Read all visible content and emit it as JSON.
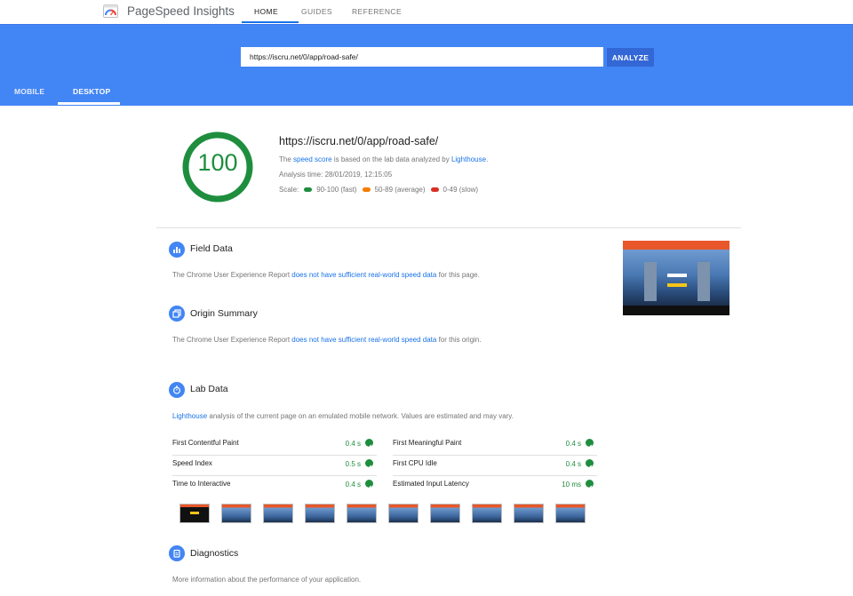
{
  "nav": {
    "brand": "PageSpeed Insights",
    "tabs": [
      "HOME",
      "GUIDES",
      "REFERENCE"
    ]
  },
  "header": {
    "url_value": "https://iscru.net/0/app/road-safe/",
    "analyze_label": "ANALYZE",
    "device_tabs": [
      "MOBILE",
      "DESKTOP"
    ],
    "active_device": "DESKTOP"
  },
  "summary": {
    "score": "100",
    "score_fraction": 1.0,
    "url": "https://iscru.net/0/app/road-safe/",
    "desc_pre": "The ",
    "desc_link1": "speed score",
    "desc_mid": " is based on the lab data analyzed by ",
    "desc_link2": "Lighthouse",
    "desc_post": ".",
    "analysis_time": "Analysis time: 28/01/2019, 12:15:05",
    "scale_label": "Scale:",
    "scale": [
      {
        "label": "90-100 (fast)",
        "color": "#1e8e3e"
      },
      {
        "label": "50-89 (average)",
        "color": "#f57c00"
      },
      {
        "label": "0-49 (slow)",
        "color": "#d93025"
      }
    ]
  },
  "field_data": {
    "title": "Field Data",
    "text_pre": "The Chrome User Experience Report ",
    "link": "does not have sufficient real-world speed data",
    "text_post": " for this page."
  },
  "origin_summary": {
    "title": "Origin Summary",
    "text_pre": "The Chrome User Experience Report ",
    "link": "does not have sufficient real-world speed data",
    "text_post": " for this origin."
  },
  "lab_data": {
    "title": "Lab Data",
    "link": "Lighthouse",
    "text": " analysis of the current page on an emulated mobile network. Values are estimated and may vary.",
    "metrics_left": [
      {
        "label": "First Contentful Paint",
        "value": "0.4 s"
      },
      {
        "label": "Speed Index",
        "value": "0.5 s"
      },
      {
        "label": "Time to Interactive",
        "value": "0.4 s"
      }
    ],
    "metrics_right": [
      {
        "label": "First Meaningful Paint",
        "value": "0.4 s"
      },
      {
        "label": "First CPU Idle",
        "value": "0.4 s"
      },
      {
        "label": "Estimated Input Latency",
        "value": "10 ms"
      }
    ]
  },
  "diagnostics": {
    "title": "Diagnostics",
    "text": "More information about the performance of your application."
  },
  "colors": {
    "brand_blue": "#4285f4",
    "fast_green": "#1e8e3e",
    "link_blue": "#1a73e8"
  }
}
